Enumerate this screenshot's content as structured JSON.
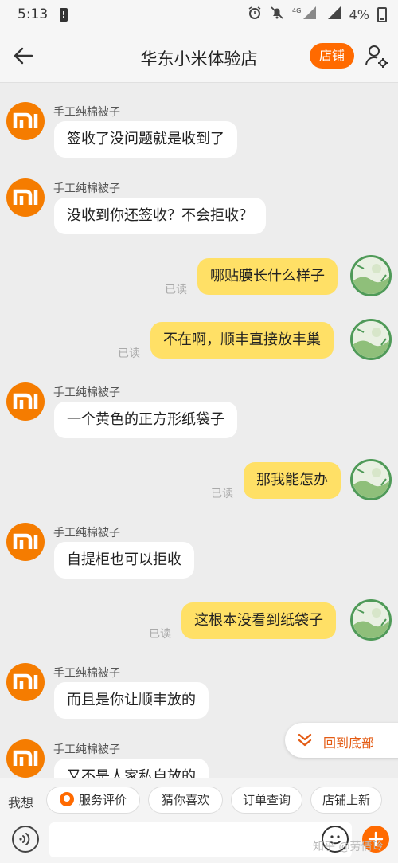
{
  "status": {
    "time": "5:13",
    "battery": "4%",
    "network": "4G",
    "alert_icon": "!"
  },
  "header": {
    "title": "华东小米体验店",
    "store_button": "店铺"
  },
  "colors": {
    "accent": "#ff6a00",
    "outgoing_bubble": "#ffe066",
    "incoming_bubble": "#ffffff",
    "read_text": "#aaaaaa"
  },
  "messages": [
    {
      "direction": "in",
      "sender": "手工纯棉被子",
      "text": "签收了没问题就是收到了"
    },
    {
      "direction": "in",
      "sender": "手工纯棉被子",
      "text": "没收到你还签收？不会拒收？"
    },
    {
      "direction": "out",
      "read": "已读",
      "text": "哪贴膜长什么样子"
    },
    {
      "direction": "out",
      "read": "已读",
      "text": "不在啊，顺丰直接放丰巢"
    },
    {
      "direction": "in",
      "sender": "手工纯棉被子",
      "text": "一个黄色的正方形纸袋子"
    },
    {
      "direction": "out",
      "read": "已读",
      "text": "那我能怎办"
    },
    {
      "direction": "in",
      "sender": "手工纯棉被子",
      "text": "自提柜也可以拒收"
    },
    {
      "direction": "out",
      "read": "已读",
      "text": "这根本没看到纸袋子"
    },
    {
      "direction": "in",
      "sender": "手工纯棉被子",
      "text": "而且是你让顺丰放的"
    },
    {
      "direction": "in",
      "sender": "手工纯棉被子",
      "text": "又不是人家私自放的"
    }
  ],
  "jump_to_bottom": {
    "label": "回到底部",
    "icon": "double-chevron-down-icon"
  },
  "quick_replies": {
    "title": "我想",
    "items": [
      "服务评价",
      "猜你喜欢",
      "订单查询",
      "店铺上新"
    ]
  },
  "input": {
    "placeholder": ""
  },
  "watermark": "知乎 @劳倩玲"
}
